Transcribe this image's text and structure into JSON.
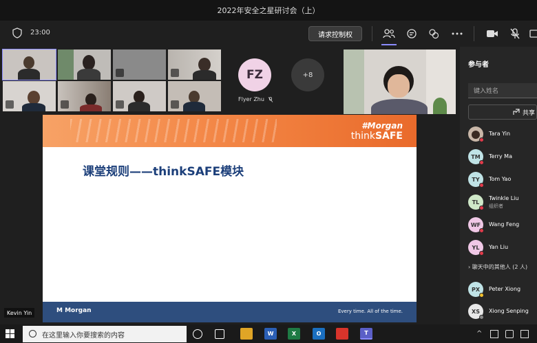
{
  "window": {
    "title": "2022年安全之星研讨会（上）"
  },
  "toolbar": {
    "time": "23:00",
    "request_control_label": "请求控制权",
    "icons": [
      "shield-icon",
      "participants-icon",
      "chat-icon",
      "reactions-icon",
      "more-icon",
      "camera-icon",
      "mic-off-icon",
      "share-icon"
    ]
  },
  "gallery": {
    "fz_initials": "FZ",
    "fz_name": "Flyer Zhu",
    "more_count": "+8"
  },
  "slide": {
    "title": "课堂规则——thinkSAFE模块",
    "brand_top": "Morgan",
    "brand_bottom_plain": "think",
    "brand_bottom_bold": "SAFE",
    "footer_brand": "Morgan",
    "footer_tagline": "Every time. All of the time."
  },
  "self_label": "Kevin Yin",
  "panel": {
    "title": "参与者",
    "search_placeholder": "键入姓名",
    "share_label": "共享",
    "people": [
      {
        "initials": "",
        "name": "Tara Yin",
        "sub": "",
        "color": "#c9b7a8"
      },
      {
        "initials": "TM",
        "name": "Terry Ma",
        "sub": "",
        "color": "#bfe3e6"
      },
      {
        "initials": "TY",
        "name": "Tom Yao",
        "sub": "",
        "color": "#bfe3e6"
      },
      {
        "initials": "TL",
        "name": "Twinkle Liu",
        "sub": "组织者",
        "color": "#cfe8c8"
      },
      {
        "initials": "WF",
        "name": "Wang Feng",
        "sub": "",
        "color": "#f0c8e6"
      },
      {
        "initials": "YL",
        "name": "Yan Liu",
        "sub": "",
        "color": "#f0c8e6"
      }
    ],
    "group_label": "聊天中的其他人 (2 人)",
    "others": [
      {
        "initials": "PX",
        "name": "Peter Xiong",
        "color": "#bfe3e6"
      },
      {
        "initials": "XS",
        "name": "Xiong Senping",
        "color": "#e8e8e8"
      }
    ]
  },
  "taskbar": {
    "search_placeholder": "在这里输入你要搜索的内容"
  }
}
